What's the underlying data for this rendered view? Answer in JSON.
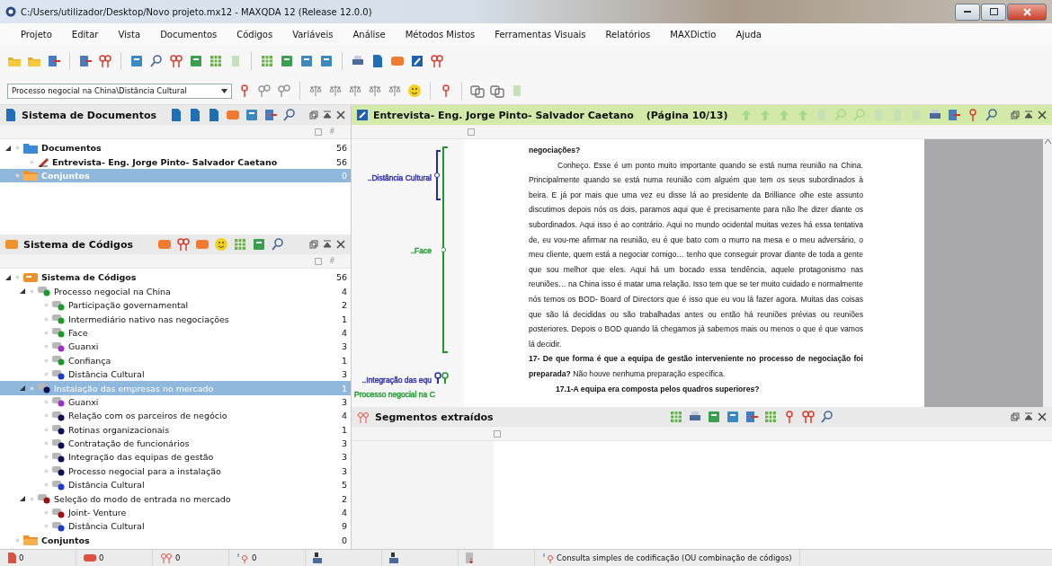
{
  "window": {
    "title": "C:/Users/utilizador/Desktop/Novo projeto.mx12 - MAXQDA 12  (Release 12.0.0)"
  },
  "menu": [
    "Projeto",
    "Editar",
    "Vista",
    "Documentos",
    "Códigos",
    "Variáveis",
    "Análise",
    "Métodos Mistos",
    "Ferramentas Visuais",
    "Relatórios",
    "MAXDictio",
    "Ajuda"
  ],
  "code_dropdown": {
    "value": "Processo negocial na China\\Distância Cultural"
  },
  "document_system": {
    "title": "Sistema de Documentos",
    "count_header": "#",
    "tree": [
      {
        "label": "Documentos",
        "count": "56",
        "kind": "folder",
        "selected": false,
        "expanded": true,
        "children": [
          {
            "label": "Entrevista- Eng. Jorge Pinto- Salvador Caetano",
            "count": "56",
            "kind": "document",
            "selected": false
          }
        ]
      },
      {
        "label": "Conjuntos",
        "count": "0",
        "kind": "set",
        "selected": true
      }
    ]
  },
  "code_system": {
    "title": "Sistema de Códigos",
    "count_header": "#",
    "tree": [
      {
        "label": "Sistema de Códigos",
        "count": "56",
        "kind": "root",
        "selected": false,
        "expanded": true,
        "children": [
          {
            "label": "Processo negocial na China",
            "count": "4",
            "kind": "code",
            "color": "#1a9a2a",
            "selected": false,
            "expanded": true,
            "children": [
              {
                "label": "Participação governamental",
                "count": "2",
                "kind": "code",
                "color": "#1a9a2a",
                "selected": false
              },
              {
                "label": "Intermediário nativo nas negociações",
                "count": "1",
                "kind": "code",
                "color": "#1a9a2a",
                "selected": false
              },
              {
                "label": "Face",
                "count": "4",
                "kind": "code",
                "color": "#1a9a2a",
                "selected": false
              },
              {
                "label": "Guanxi",
                "count": "3",
                "kind": "code",
                "color": "#a030c8",
                "selected": false
              },
              {
                "label": "Confiança",
                "count": "1",
                "kind": "code",
                "color": "#1a9a2a",
                "selected": false
              },
              {
                "label": "Distância Cultural",
                "count": "3",
                "kind": "code",
                "color": "#1a3ad0",
                "selected": false
              }
            ]
          },
          {
            "label": "Instalação das empresas no mercado",
            "count": "1",
            "kind": "code",
            "color": "#10105a",
            "selected": true,
            "expanded": true,
            "children": [
              {
                "label": "Guanxi",
                "count": "3",
                "kind": "code",
                "color": "#a030c8",
                "selected": false
              },
              {
                "label": "Relação com os parceiros de negócio",
                "count": "4",
                "kind": "code",
                "color": "#10105a",
                "selected": false
              },
              {
                "label": "Rotinas organizacionais",
                "count": "1",
                "kind": "code",
                "color": "#10105a",
                "selected": false
              },
              {
                "label": "Contratação de funcionários",
                "count": "3",
                "kind": "code",
                "color": "#10105a",
                "selected": false
              },
              {
                "label": "Integração das equipas de gestão",
                "count": "3",
                "kind": "code",
                "color": "#10105a",
                "selected": false
              },
              {
                "label": "Processo negocial para a instalação",
                "count": "3",
                "kind": "code",
                "color": "#10105a",
                "selected": false
              },
              {
                "label": "Distância Cultural",
                "count": "5",
                "kind": "code",
                "color": "#1a3ad0",
                "selected": false
              }
            ]
          },
          {
            "label": "Seleção do modo de entrada no mercado",
            "count": "2",
            "kind": "code",
            "color": "#a01010",
            "selected": false,
            "expanded": true,
            "children": [
              {
                "label": "Joint- Venture",
                "count": "4",
                "kind": "code",
                "color": "#a01010",
                "selected": false
              },
              {
                "label": "Distância Cultural",
                "count": "9",
                "kind": "code",
                "color": "#1a3ad0",
                "selected": false
              }
            ]
          }
        ]
      },
      {
        "label": "Conjuntos",
        "count": "0",
        "kind": "set",
        "selected": false
      }
    ]
  },
  "document_browser": {
    "title": "Entrevista- Eng. Jorge Pinto- Salvador Caetano",
    "page": "(Página 10/13)",
    "margin_codes": [
      {
        "label": "..Distância Cultural",
        "color": "#2a2aa8"
      },
      {
        "label": "..Face",
        "color": "#1a9a2a"
      },
      {
        "label": "..Integração das equ",
        "color": "#2a2aa8"
      },
      {
        "label": "Processo negocial na C",
        "color": "#1a9a2a"
      }
    ],
    "paragraphs": [
      {
        "kind": "question",
        "text": "negociações?"
      },
      {
        "kind": "answer",
        "text": "Conheço. Esse é um ponto muito importante quando se está numa reunião na China. Principalmente quando se está numa reunião com alguém que tem os seus subordinados à beira. E já por mais que uma vez eu disse lá ao presidente da Brilliance olhe este assunto discutimos depois nós os dois, paramos aqui que é precisamente para não lhe dizer diante os subordinados. Aqui isso é ao contrário. Aqui no mundo ocidental muitas vezes há essa tentativa de, eu vou-me afirmar na reunião, eu é que bato com o murro na mesa e o meu adversário, o meu cliente, quem está a negociar comigo… tenho que conseguir provar diante de toda a gente que sou melhor que eles. Aqui há um bocado essa tendência, aquele protagonismo nas reuniões… na China isso é matar uma relação. Isso tem que se ter muito cuidado e normalmente nós temos os BOD- Board of Directors que é isso que eu vou lá fazer agora. Muitas das coisas que são lá decididas ou são trabalhadas antes ou então há reuniões prévias ou reuniões posteriores. Depois o BOD  quando lá chegamos já sabemos mais ou menos o que é que vamos lá decidir."
      },
      {
        "kind": "plain",
        "text": "**17- De que forma é que a equipa de gestão interveniente no processo de negociação foi preparada?** Não houve nenhuma preparação específica."
      },
      {
        "kind": "subquestion",
        "text": "17.1-A equipa era composta pelos quadros superiores?"
      }
    ]
  },
  "retrieved_segments": {
    "title": "Segmentos extraídos"
  },
  "status_bar": {
    "counters": [
      {
        "kind": "documents",
        "text": "0"
      },
      {
        "kind": "codes",
        "text": "0"
      },
      {
        "kind": "segments",
        "text": "0"
      },
      {
        "kind": "memos",
        "text": "0"
      }
    ],
    "message": "Consulta simples de codificação (OU combinação de códigos)"
  }
}
